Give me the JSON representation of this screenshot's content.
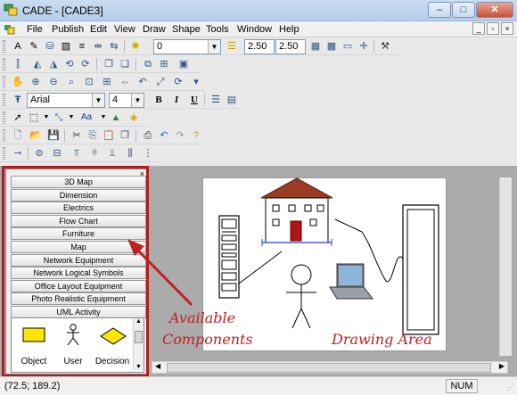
{
  "window": {
    "title": "CADE - [CADE3]"
  },
  "menu": [
    "File",
    "Publish",
    "Edit",
    "View",
    "Draw",
    "Shape",
    "Tools",
    "Window",
    "Help"
  ],
  "toolbar": {
    "line_style_value": "0",
    "width_value": "2.50",
    "height_value": "2.50",
    "font_name": "Arial",
    "font_size": "4",
    "bold_label": "B",
    "italic_label": "I",
    "underline_label": "U",
    "text_tool_label": "Aa"
  },
  "components": {
    "items": [
      "3D Map",
      "Dimension",
      "Electrics",
      "Flow Chart",
      "Furniture",
      "Map",
      "Network Equipment",
      "Network Logical Symbols",
      "Office Layout Equipment",
      "Photo Realistic Equipment",
      "UML Activity"
    ],
    "shapes": [
      "Object",
      "User",
      "Decision"
    ]
  },
  "annotations": {
    "available_components_line1": "Available",
    "available_components_line2": "Components",
    "drawing_area": "Drawing Area"
  },
  "status": {
    "coordinates": "(72.5; 189.2)",
    "num": "NUM"
  },
  "colors": {
    "annotation_red": "#c02020",
    "roof": "#9a3b24",
    "door": "#b31313",
    "dimension_blue": "#2a3ccf",
    "shape_yellow": "#ffe600"
  }
}
